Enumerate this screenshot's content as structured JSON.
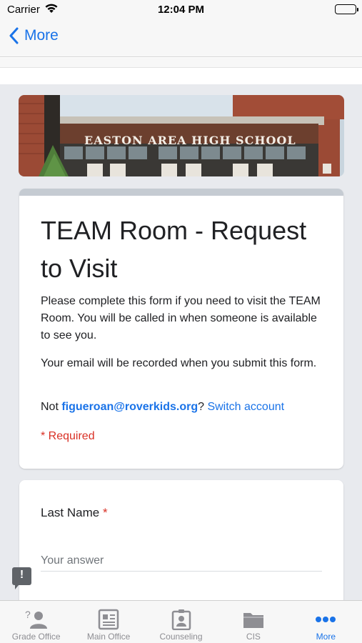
{
  "status_bar": {
    "carrier": "Carrier",
    "time": "12:04 PM"
  },
  "nav": {
    "back_label": "More"
  },
  "banner": {
    "school_name": "EASTON AREA HIGH SCHOOL"
  },
  "form": {
    "title": "TEAM Room - Request to Visit",
    "description_1": "Please complete this form if you need to visit the TEAM Room. You will be called in when someone is available to see you.",
    "description_2": "Your email will be recorded when you submit this form.",
    "account_prefix": "Not ",
    "account_email": "figueroan@roverkids.org",
    "account_suffix": "?",
    "switch_account": "Switch account",
    "required_note": "* Required",
    "question": {
      "label": "Last Name",
      "required_star": "*",
      "placeholder": "Your answer"
    }
  },
  "feedback_glyph": "!",
  "tabs": [
    {
      "label": "Grade Office",
      "icon": "person-question-icon",
      "active": false
    },
    {
      "label": "Main Office",
      "icon": "newspaper-icon",
      "active": false
    },
    {
      "label": "Counseling",
      "icon": "id-badge-icon",
      "active": false
    },
    {
      "label": "CIS",
      "icon": "folder-icon",
      "active": false
    },
    {
      "label": "More",
      "icon": "more-dots-icon",
      "active": true
    }
  ],
  "colors": {
    "accent": "#1a73e8",
    "required": "#d93025",
    "form_stripe": "#c5cbd2",
    "page_background": "#e8eaee",
    "tab_inactive": "#8e8e93"
  }
}
